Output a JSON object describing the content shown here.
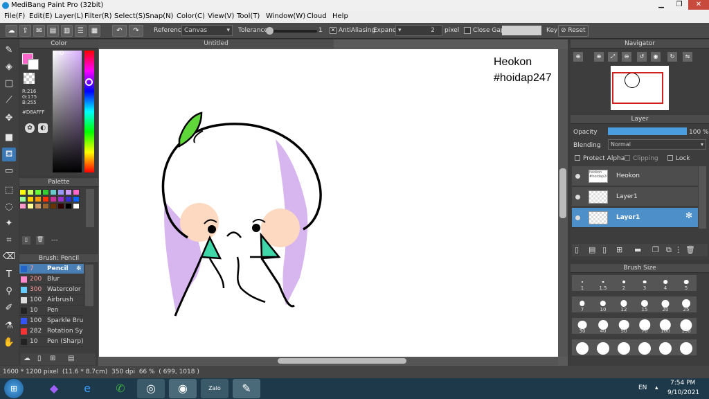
{
  "window": {
    "title": "MediBang Paint Pro (32bit)"
  },
  "menu": [
    "File(F)",
    "Edit(E)",
    "Layer(L)",
    "Filter(R)",
    "Select(S)",
    "Snap(N)",
    "Color(C)",
    "View(V)",
    "Tool(T)",
    "Window(W)",
    "Cloud",
    "Help"
  ],
  "toolbar": {
    "reference_label": "Reference",
    "reference_value": "Canvas",
    "tolerance_label": "Tolerance",
    "tolerance_value": "1",
    "antialiasing_label": "AntiAliasing",
    "expand_label": "Expand",
    "expand_value": "2",
    "expand_unit": "pixel",
    "close_gaps_label": "Close Gaps",
    "key_label": "Key",
    "reset_label": "Reset"
  },
  "color_panel": {
    "title": "Color",
    "r": "R:216",
    "g": "G:175",
    "b": "B:255",
    "hex": "#D8AFFF",
    "current_color": "#D8AFFF"
  },
  "palette_panel": {
    "title": "Palette",
    "colors": [
      "#ffff00",
      "#ccff66",
      "#66ff33",
      "#33cc33",
      "#66cccc",
      "#9999ff",
      "#cc99ff",
      "#ff66cc",
      "#99ff99",
      "#ffcc00",
      "#ff9900",
      "#ff3300",
      "#cc3399",
      "#9933cc",
      "#3333cc",
      "#0066ff",
      "#ff99cc",
      "#ffff99",
      "#cc9966",
      "#996633",
      "#663300",
      "#330000",
      "#000000",
      "#ffffff"
    ],
    "extra": "---"
  },
  "brush_panel": {
    "title": "Brush: Pencil",
    "items": [
      {
        "size": "7",
        "name": "Pencil",
        "color": "#2266cc"
      },
      {
        "size": "200",
        "name": "Blur",
        "color": "#ff88cc"
      },
      {
        "size": "300",
        "name": "Watercolor (V",
        "color": "#66ccff"
      },
      {
        "size": "100",
        "name": "Airbrush",
        "color": "#dddddd"
      },
      {
        "size": "10",
        "name": "Pen",
        "color": "#222222"
      },
      {
        "size": "100",
        "name": "Sparkle Brush",
        "color": "#3355ff"
      },
      {
        "size": "282",
        "name": "Rotation Sym",
        "color": "#ff3333"
      },
      {
        "size": "10",
        "name": "Pen (Sharp)",
        "color": "#222222"
      }
    ]
  },
  "canvas": {
    "tab_title": "Untitled",
    "text_line1": "Heokon",
    "text_line2": "#hoidap247"
  },
  "navigator": {
    "title": "Navigator"
  },
  "layer_panel": {
    "title": "Layer",
    "opacity_label": "Opacity",
    "opacity_value": "100 %",
    "blending_label": "Blending",
    "blending_value": "Normal",
    "protect_alpha_label": "Protect Alpha",
    "clipping_label": "Clipping",
    "lock_label": "Lock",
    "layers": [
      {
        "name": "Heokon",
        "thumb_text": "heokon #hoidap247",
        "selected": false
      },
      {
        "name": "Layer1",
        "thumb_text": "",
        "selected": false
      },
      {
        "name": "Layer1",
        "thumb_text": "",
        "selected": true
      }
    ]
  },
  "brush_size_panel": {
    "title": "Brush Size",
    "sizes": [
      "1",
      "1.5",
      "2",
      "3",
      "4",
      "5",
      "7",
      "10",
      "12",
      "15",
      "20",
      "25",
      "30",
      "40",
      "50",
      "70",
      "100",
      "150",
      "",
      "",
      "",
      "",
      "",
      ""
    ]
  },
  "status": {
    "dimensions": "1600 * 1200 pixel",
    "physical": "(11.6 * 8.7cm)",
    "dpi": "350 dpi",
    "zoom": "66 %",
    "coords": "( 699, 1018 )"
  },
  "taskbar": {
    "lang": "EN",
    "time": "7:54 PM",
    "date": "9/10/2021"
  }
}
